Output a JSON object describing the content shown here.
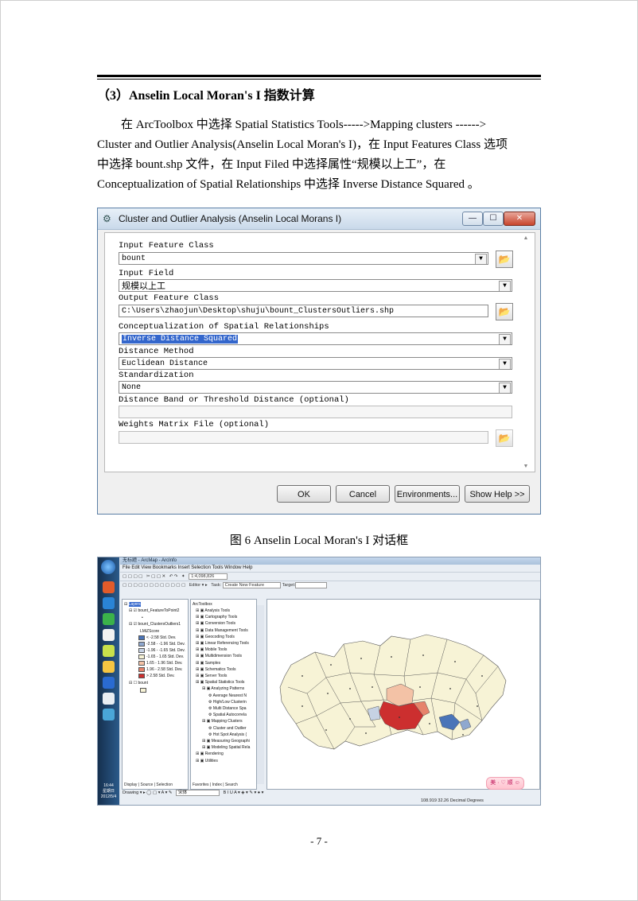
{
  "doc": {
    "heading": "（3）Anselin Local Moran's I 指数计算",
    "para_lines": [
      "在  ArcToolbox  中选择 Spatial Statistics Tools----->Mapping clusters ------>",
      "Cluster and Outlier Analysis(Anselin Local Moran's I)，在 Input Features Class 选项",
      "中选择 bount.shp  文件，在 Input Filed  中选择属性“规模以上工”，在",
      "Conceptualization of Spatial Relationships 中选择 Inverse Distance Squared  。"
    ],
    "figure_caption": "图 6   Anselin Local Moran's I 对话框",
    "page_number": "- 7 -"
  },
  "dialog": {
    "title": "Cluster and Outlier Analysis (Anselin Local Morans I)",
    "fields": {
      "input_feature_class_label": "Input Feature Class",
      "input_feature_class_value": "bount",
      "input_field_label": "Input Field",
      "input_field_value": "规模以上工",
      "output_feature_class_label": "Output Feature Class",
      "output_feature_class_value": "C:\\Users\\zhaojun\\Desktop\\shuju\\bount_ClustersOutliers.shp",
      "conceptualization_label": "Conceptualization of Spatial Relationships",
      "conceptualization_value": "Inverse Distance Squared",
      "distance_method_label": "Distance Method",
      "distance_method_value": "Euclidean Distance",
      "standardization_label": "Standardization",
      "standardization_value": "None",
      "distance_band_label": "Distance Band or Threshold Distance (optional)",
      "weights_matrix_label": "Weights Matrix File (optional)"
    },
    "buttons": {
      "ok": "OK",
      "cancel": "Cancel",
      "environments": "Environments...",
      "show_help": "Show Help >>"
    }
  },
  "arcmap": {
    "title": "无标题 - ArcMap - ArcInfo",
    "menu": "File  Edit  View  Bookmarks  Insert  Selection  Tools  Window  Help",
    "scale": "1:4,098,826",
    "editor": "Editor ▾",
    "task_label": "Task:",
    "task_value": "Create New Feature",
    "target_label": "Target:",
    "toc": {
      "root": "Layers",
      "layer1": "bount_FeatureToPoint2",
      "layer2": "bount_ClustersOutliers1",
      "field": "LMiZScore",
      "classes": [
        "< -2.58 Std. Dev.",
        "-2.58 - -1.96 Std. Dev.",
        "-1.96 - -1.65 Std. Dev.",
        "-1.65 - 1.65 Std. Dev.",
        "1.65 - 1.96 Std. Dev.",
        "1.96 - 2.58 Std. Dev.",
        "> 2.58 Std. Dev."
      ],
      "class_colors": [
        "#4a74b8",
        "#8fa8cf",
        "#c6d2e4",
        "#f7f3d6",
        "#f3c2a6",
        "#e6826a",
        "#cc2f2f"
      ],
      "layer3": "bount",
      "tabs": [
        "Display",
        "Source",
        "Selection"
      ]
    },
    "toolbox": {
      "root": "ArcToolbox",
      "items": [
        "Analysis Tools",
        "Cartography Tools",
        "Conversion Tools",
        "Data Management Tools",
        "Geocoding Tools",
        "Linear Referencing Tools",
        "Mobile Tools",
        "Multidimension Tools",
        "Samples",
        "Schematics Tools",
        "Server Tools",
        "Spatial Statistics Tools",
        "Analyzing Patterns",
        "Average Nearest N",
        "High/Low Clusterin",
        "Multi Distance Spa",
        "Spatial Autocorrela",
        "Mapping Clusters",
        "Cluster and Outlier",
        "Hot Spot Analysis (",
        "Measuring Geographi",
        "Modeling Spatial Rela",
        "Rendering",
        "Utilities"
      ],
      "tabs": [
        "Favorites",
        "Index",
        "Search"
      ]
    },
    "drawing": "Drawing ▾",
    "font": "宋体",
    "status_coords": "108.919  32.26 Decimal Degrees",
    "badge": "美 · ♡ 顺 ☺",
    "clock_time": "16:44",
    "clock_day": "星期日",
    "clock_date": "2012/5/4"
  }
}
